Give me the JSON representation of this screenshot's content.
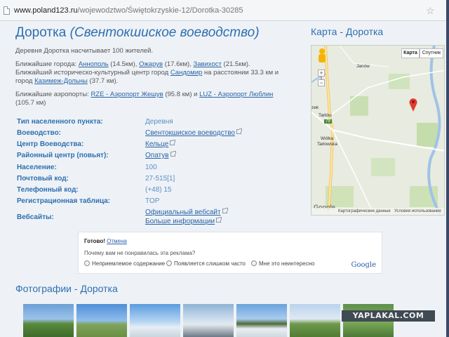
{
  "browser": {
    "url_domain": "www.poland123.ru",
    "url_path": "/wojewodztwo/Świętokrzyskie-12/Dorotka-30285"
  },
  "page": {
    "title": "Доротка",
    "title_region": "(Свентокшиское воеводство)",
    "intro": "Деревня Доротка насчитывает 100 жителей.",
    "nearby": {
      "prefix": "Ближайшие города: ",
      "city1": "Аннополь",
      "city1_dist": " (14.5км), ",
      "city2": "Ожарув",
      "city2_dist": " (17.6км), ",
      "city3": "Завихост",
      "city3_dist": " (21.5км).",
      "line2_prefix": "Ближайший историческо-культурный центр город ",
      "center": "Сандомир",
      "line2_suffix": " на расстоянии 33.3 км и",
      "line3_prefix": "город ",
      "center2": "Казимеж-Дольны",
      "line3_suffix": " (37.7 км)."
    },
    "airports": {
      "prefix": "Ближайшие аэропорты: ",
      "a1": "RZE - Аэропорт Жешув",
      "a1_dist": " (95.8 км) и ",
      "a2": "LUZ - Аэропорт Люблин",
      "line2": "(105.7 км)"
    }
  },
  "facts": [
    {
      "label": "Тип населенного пункта:",
      "value": "Деревня"
    },
    {
      "label": "Воеводство:",
      "value": "Свентокшиское воеводство"
    },
    {
      "label": "Центр Воеводства:",
      "value": "Кельце"
    },
    {
      "label": "Районный центр (повьят):",
      "value": "Опатув"
    },
    {
      "label": "Население:",
      "value": "100"
    },
    {
      "label": "Почтовый код:",
      "value": "27-515[1]"
    },
    {
      "label": "Телефонный код:",
      "value": "(+48) 15"
    },
    {
      "label": "Регистрационная таблица:",
      "value": "TOP"
    },
    {
      "label": "Вебсайты:",
      "value": "Официальный вебсайт",
      "value2": "Больше информации"
    }
  ],
  "map": {
    "title": "Карта - Доротка",
    "type_map": "Карта",
    "type_sat": "Спутник",
    "labels": {
      "janow": "Janów",
      "tarlow": "Tarłów",
      "wolka": "Wólka",
      "tarlowska": "Tarłowska",
      "zek": "zek",
      "road": "79"
    },
    "footer_data": "Картографические данные",
    "footer_terms": "Условия использования",
    "google": "Google"
  },
  "ad": {
    "done": "Готово!",
    "cancel": "Отмена",
    "question": "Почему вам не понравилась эта реклама?",
    "opt1": "Неприемлемое содержание",
    "opt2": "Появляется слишком часто",
    "opt3": "Мне это неинтересно",
    "google": "Google"
  },
  "photos": {
    "title": "Фотографии - Доротка"
  },
  "watermark": "YAPLAKAL.COM"
}
